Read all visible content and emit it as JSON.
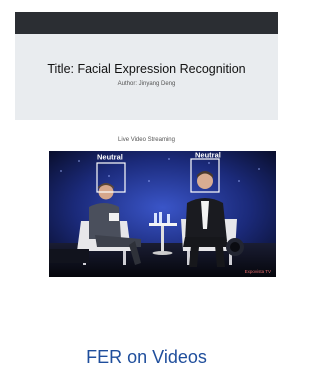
{
  "header": {
    "title": "Title: Facial Expression Recognition",
    "author": "Author: Jinyang Deng"
  },
  "stream": {
    "caption": "Live Video Streaming",
    "detections": [
      {
        "label": "Neutral"
      },
      {
        "label": "Neutral"
      }
    ],
    "watermark": "Expovista TV"
  },
  "footer": {
    "title": "FER on Videos"
  },
  "colors": {
    "topbar": "#2b2e33",
    "panel": "#e9ecef",
    "footer_text": "#1f4e9c",
    "stage_blue": "#0d1438",
    "detection_box": "#ffffff"
  }
}
